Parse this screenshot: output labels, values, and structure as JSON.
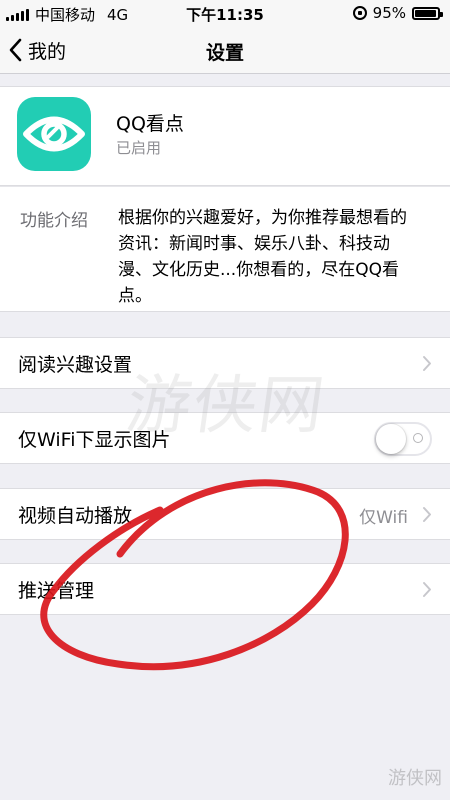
{
  "status_bar": {
    "carrier": "中国移动",
    "network": "4G",
    "time": "下午11:35",
    "battery_percent": "95%",
    "battery_level": 0.95,
    "icons": [
      "signal-bars-icon",
      "orientation-lock-icon",
      "battery-icon"
    ]
  },
  "nav": {
    "back_label": "我的",
    "title": "设置",
    "back_icon": "chevron-left-icon"
  },
  "app": {
    "name": "QQ看点",
    "status": "已启用",
    "icon": "eye-logo-icon",
    "icon_color": "#22cdb4"
  },
  "description": {
    "label": "功能介绍",
    "text": "根据你的兴趣爱好，为你推荐最想看的资讯：新闻时事、娱乐八卦、科技动漫、文化历史...你想看的，尽在QQ看点。"
  },
  "settings": {
    "reading_interest": {
      "label": "阅读兴趣设置"
    },
    "wifi_images": {
      "label": "仅WiFi下显示图片",
      "enabled": false
    },
    "video_autoplay": {
      "label": "视频自动播放",
      "value": "仅Wifi"
    },
    "push_management": {
      "label": "推送管理"
    }
  },
  "watermark": {
    "text": "游侠网",
    "corner_text": "游侠网"
  },
  "annotation": {
    "color": "#d9161b"
  }
}
